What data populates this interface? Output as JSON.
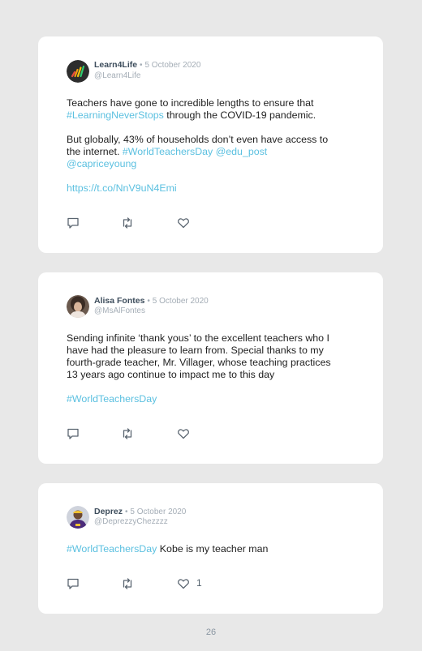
{
  "tweets": [
    {
      "name": "Learn4Life",
      "separator": "•",
      "date": "5 October 2020",
      "handle": "@Learn4Life",
      "avatar": "learn4life-logo-avatar",
      "lines": [
        {
          "p1": "Teachers have gone to incredible lengths to ensure that"
        },
        {
          "l1": "#LearningNeverStops",
          "p2": " through the COVID-19 pandemic."
        },
        {
          "p1": "But globally, 43% of households don’t even have access to"
        },
        {
          "p1": "the internet. ",
          "l1": "#WorldTeachersDay",
          "p2": " ",
          "l2": "@edu_post"
        },
        {
          "l1": "@capriceyoung"
        },
        {
          "l1": "https://t.co/NnV9uN4Emi"
        }
      ],
      "like_count": ""
    },
    {
      "name": "Alisa Fontes",
      "separator": "•",
      "date": "5 October 2020",
      "handle": "@MsAlFontes",
      "avatar": "profile-photo-avatar",
      "lines": [
        {
          "p1": "Sending infinite ‘thank yous’ to the excellent teachers who I"
        },
        {
          "p1": "have had the pleasure to learn from. Special thanks to my"
        },
        {
          "p1": "fourth-grade teacher, Mr. Villager, whose teaching practices"
        },
        {
          "p1": "13 years ago continue to impact me to this day"
        },
        {
          "l1": "#WorldTeachersDay"
        }
      ],
      "like_count": ""
    },
    {
      "name": "Deprez",
      "separator": "•",
      "date": "5 October 2020",
      "handle": "@DeprezzyChezzzz",
      "avatar": "profile-photo-avatar",
      "lines": [
        {
          "l1": "#WorldTeachersDay",
          "p2": " Kobe is my teacher man"
        }
      ],
      "like_count": "1"
    }
  ],
  "icons": {
    "reply": "reply-icon",
    "retweet": "retweet-icon",
    "like": "like-icon"
  },
  "colors": {
    "background": "#e8e8e8",
    "card": "#ffffff",
    "link": "#5bc0e0",
    "name": "#3d4d5c",
    "meta": "#a4adb6",
    "icon": "#5a6570"
  },
  "page_number": "26"
}
